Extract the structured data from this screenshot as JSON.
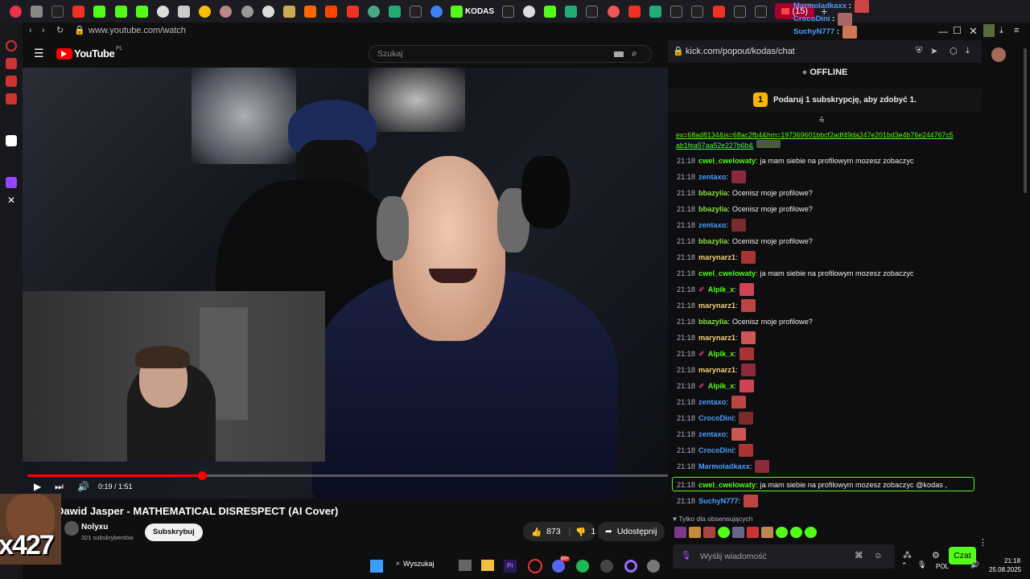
{
  "browser": {
    "address": "www.youtube.com/watch",
    "tab_badge": "(15)",
    "kodas_tab": "KODAS"
  },
  "overlay_top": [
    {
      "user": "Marmoladkaxx",
      "color": "#4a9eff"
    },
    {
      "user": "CrocoDini",
      "color": "#4a9eff"
    },
    {
      "user": "SuchyN777",
      "color": "#4a9eff"
    }
  ],
  "youtube": {
    "logo_text": "YouTube",
    "region": "PL",
    "search_placeholder": "Szukaj",
    "time_current": "0:19",
    "time_total": "1:51",
    "time_display": "0:19 / 1:51",
    "progress_fraction": 0.272,
    "video_title": "Dawid Jasper - MATHEMATICAL DISRESPECT (AI Cover)",
    "channel_name": "Nolyxu",
    "subscribers": "321 subskrybentów",
    "subscribe_label": "Subskrybuj",
    "likes": "873",
    "dislikes": "1",
    "share_label": "Udostępnij"
  },
  "stream_overlay_text": "x427",
  "chat": {
    "url": "kick.com/popout/kodas/chat",
    "status": "OFFLINE",
    "gift_text": "Podaruj 1 subskrypcję, aby zdobyć 1.",
    "gift_count": "1",
    "link_lines": [
      "ex=68ad8134&is=68ac2fb4&hm=197369601bbcf2adf49da247e201bd3e4b76e244767c5",
      "ab1fea57aa52e227b6b&"
    ],
    "messages": [
      {
        "time": "21:18",
        "user": "cwel_cwelowaty",
        "color": "#53fc18",
        "text": "ja mam siebie na profilowym mozesz zobaczyc",
        "emote": false,
        "badge": false
      },
      {
        "time": "21:18",
        "user": "zentaxo",
        "color": "#4a9eff",
        "text": "",
        "emote": true,
        "badge": false
      },
      {
        "time": "21:18",
        "user": "bbazylia",
        "color": "#8adf3a",
        "text": "Ocenisz moje profilowe?",
        "emote": false,
        "badge": false
      },
      {
        "time": "21:18",
        "user": "bbazylia",
        "color": "#8adf3a",
        "text": "Ocenisz moje profilowe?",
        "emote": false,
        "badge": false
      },
      {
        "time": "21:18",
        "user": "zentaxo",
        "color": "#4a9eff",
        "text": "",
        "emote": true,
        "badge": false
      },
      {
        "time": "21:18",
        "user": "bbazylia",
        "color": "#8adf3a",
        "text": "Ocenisz moje profilowe?",
        "emote": false,
        "badge": false
      },
      {
        "time": "21:18",
        "user": "marynarz1",
        "color": "#f4d27a",
        "text": "",
        "emote": true,
        "badge": false
      },
      {
        "time": "21:18",
        "user": "cwel_cwelowaty",
        "color": "#53fc18",
        "text": "ja mam siebie na profilowym mozesz zobaczyc",
        "emote": false,
        "badge": false
      },
      {
        "time": "21:18",
        "user": "Alpik_x",
        "color": "#53fc18",
        "text": "",
        "emote": true,
        "badge": true
      },
      {
        "time": "21:18",
        "user": "marynarz1",
        "color": "#f4d27a",
        "text": "",
        "emote": true,
        "badge": false
      },
      {
        "time": "21:18",
        "user": "bbazylia",
        "color": "#8adf3a",
        "text": "Ocenisz moje profilowe?",
        "emote": false,
        "badge": false
      },
      {
        "time": "21:18",
        "user": "marynarz1",
        "color": "#f4d27a",
        "text": "",
        "emote": true,
        "badge": false
      },
      {
        "time": "21:18",
        "user": "Alpik_x",
        "color": "#53fc18",
        "text": "",
        "emote": true,
        "badge": true
      },
      {
        "time": "21:18",
        "user": "marynarz1",
        "color": "#f4d27a",
        "text": "",
        "emote": true,
        "badge": false
      },
      {
        "time": "21:18",
        "user": "Alpik_x",
        "color": "#53fc18",
        "text": "",
        "emote": true,
        "badge": true
      },
      {
        "time": "21:18",
        "user": "zentaxo",
        "color": "#4a9eff",
        "text": "",
        "emote": true,
        "badge": false
      },
      {
        "time": "21:18",
        "user": "CrocoDini",
        "color": "#4a9eff",
        "text": "",
        "emote": true,
        "badge": false
      },
      {
        "time": "21:18",
        "user": "zentaxo",
        "color": "#4a9eff",
        "text": "",
        "emote": true,
        "badge": false
      },
      {
        "time": "21:18",
        "user": "CrocoDini",
        "color": "#4a9eff",
        "text": "",
        "emote": true,
        "badge": false
      },
      {
        "time": "21:18",
        "user": "Marmoladkaxx",
        "color": "#4a9eff",
        "text": "",
        "emote": true,
        "badge": false
      },
      {
        "time": "21:18",
        "user": "cwel_cwelowaty",
        "color": "#53fc18",
        "text": "ja mam siebie na profilowym mozesz zobaczyc @kodas ,",
        "emote": false,
        "badge": false,
        "highlight": true
      },
      {
        "time": "21:18",
        "user": "SuchyN777",
        "color": "#4a9eff",
        "text": "",
        "emote": true,
        "badge": false
      }
    ],
    "followers_only": "Tylko dla obserwujących",
    "input_placeholder": "Wyślij wiadomość",
    "send_label": "Czat"
  },
  "taskbar": {
    "search_label": "Wyszukaj",
    "lang": "POL",
    "time": "21:18",
    "date": "25.08.2025",
    "discord_badge": "99+"
  },
  "colors": {
    "kick_green": "#53fc18",
    "yt_red": "#ff0000",
    "tab_active": "#a3002d"
  }
}
